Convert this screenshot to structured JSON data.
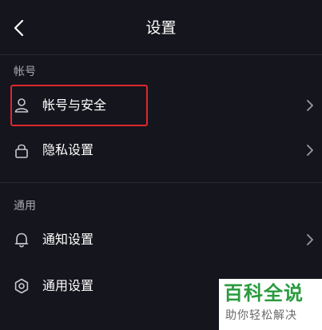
{
  "header": {
    "title": "设置"
  },
  "sections": {
    "account": {
      "label": "帐号",
      "items": [
        {
          "label": "帐号与安全",
          "icon": "person-icon"
        },
        {
          "label": "隐私设置",
          "icon": "lock-icon"
        }
      ]
    },
    "general": {
      "label": "通用",
      "items": [
        {
          "label": "通知设置",
          "icon": "bell-icon"
        },
        {
          "label": "通用设置",
          "icon": "gear-icon"
        }
      ]
    }
  },
  "highlight_color": "#e0262e",
  "watermark": {
    "main": "百科全说",
    "sub": "助你轻松解决"
  }
}
